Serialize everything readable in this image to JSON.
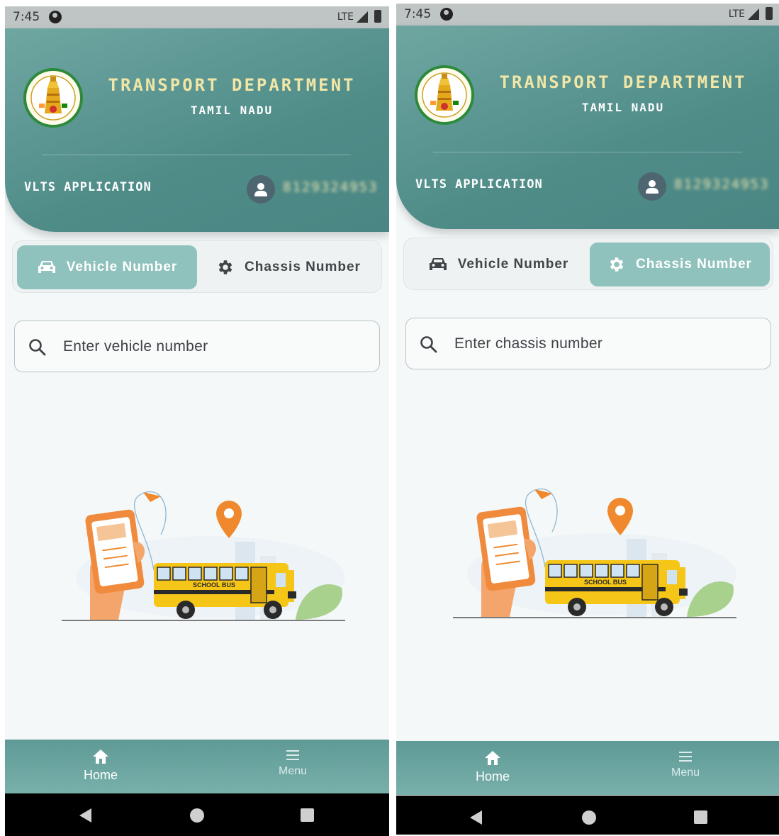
{
  "screens": [
    {
      "status": {
        "time": "7:45",
        "network": "LTE"
      },
      "header": {
        "title": "TRANSPORT DEPARTMENT",
        "subtitle": "TAMIL NADU",
        "app_name": "VLTS APPLICATION",
        "user_phone": "8129324953"
      },
      "toggle": {
        "vehicle_label": "Vehicle Number",
        "chassis_label": "Chassis Number",
        "active": "vehicle"
      },
      "search": {
        "placeholder": "Enter vehicle number"
      },
      "illustration": {
        "bus_text": "SCHOOL BUS"
      },
      "bottom_nav": {
        "home_label": "Home",
        "menu_label": "Menu"
      }
    },
    {
      "status": {
        "time": "7:45",
        "network": "LTE"
      },
      "header": {
        "title": "TRANSPORT DEPARTMENT",
        "subtitle": "TAMIL NADU",
        "app_name": "VLTS APPLICATION",
        "user_phone": "8129324953"
      },
      "toggle": {
        "vehicle_label": "Vehicle Number",
        "chassis_label": "Chassis Number",
        "active": "chassis"
      },
      "search": {
        "placeholder": "Enter chassis number"
      },
      "illustration": {
        "bus_text": "SCHOOL BUS"
      },
      "bottom_nav": {
        "home_label": "Home",
        "menu_label": "Menu"
      }
    }
  ],
  "colors": {
    "header_teal": "#4f8c88",
    "accent_title": "#f1e6a6",
    "active_segment": "#8fc2bd",
    "bus_yellow": "#f5c518",
    "pin_orange": "#f0892e"
  },
  "icons": [
    "emblem-logo",
    "user-icon",
    "car-icon",
    "gear-icon",
    "search-icon",
    "home-icon",
    "menu-icon",
    "back-icon",
    "home-circle-icon",
    "recents-icon"
  ]
}
